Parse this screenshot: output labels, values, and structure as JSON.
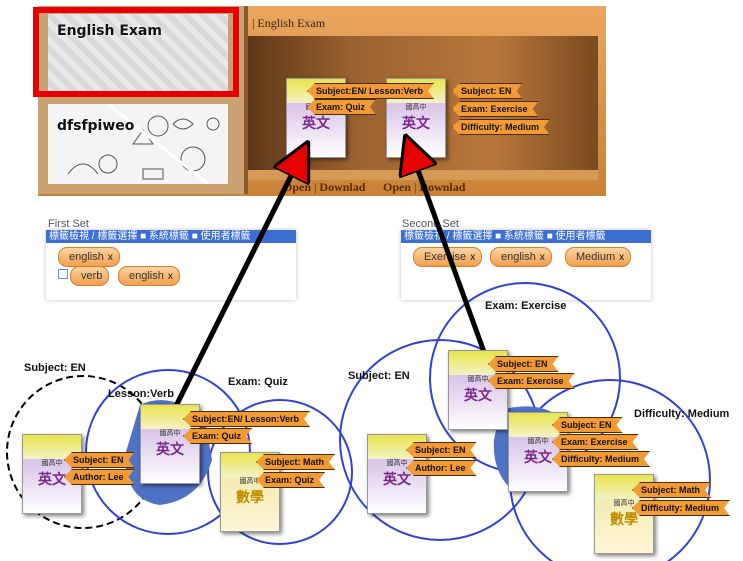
{
  "shelf": {
    "papers": [
      "English Exam",
      "dfsfpiweo"
    ],
    "title": "| English Exam",
    "links": [
      {
        "open": "Open",
        "sep": "|",
        "download": "Downlad"
      },
      {
        "open": "Open",
        "sep": "|",
        "download": "Downlad"
      }
    ],
    "book1_tags": [
      "Subject:EN/ Lesson:Verb",
      "Exam: Quiz"
    ],
    "book2_tags": [
      "Subject: EN",
      "Exam: Exercise",
      "Difficulty: Medium"
    ]
  },
  "first_set": {
    "title": "First Set",
    "bar": "標籤檢視 / 標籤選擇  ■ 系統標籤  ■ 使用者標籤",
    "chips": [
      "english",
      "verb",
      "english"
    ],
    "chip_x": "x"
  },
  "second_set": {
    "title": "Second Set",
    "bar": "標籤檢視 / 標籤選擇  ■ 系統標籤  ■ 使用者標籤",
    "chips": [
      "Exercise",
      "english",
      "Medium"
    ],
    "chip_x": "x"
  },
  "venn_left": {
    "labels": [
      "Subject: EN",
      "Lesson:Verb",
      "Exam: Quiz"
    ],
    "book_a_tags": [
      "Subject: EN",
      "Author: Lee"
    ],
    "book_b_tags": [
      "Subject:EN/ Lesson:Verb",
      "Exam: Quiz"
    ],
    "book_c_tags": [
      "Subject: Math",
      "Exam: Quiz"
    ]
  },
  "venn_right": {
    "labels": [
      "Subject: EN",
      "Exam: Exercise",
      "Difficulty: Medium"
    ],
    "book_a_tags": [
      "Subject: EN",
      "Exam: Exercise"
    ],
    "book_b_tags": [
      "Subject: EN",
      "Author: Lee"
    ],
    "book_c_tags": [
      "Subject: EN",
      "Exam: Exercise",
      "Difficulty: Medium"
    ],
    "book_d_tags": [
      "Subject: Math",
      "Difficulty: Medium"
    ]
  },
  "book_text": {
    "english": "英文",
    "math": "數學",
    "series": "國高中"
  },
  "colors": {
    "red_box": "#e60000",
    "tag_orange": "#f29a33",
    "circle_blue": "#3340d6",
    "highlight_blue": "#4f73c4",
    "bar_blue": "#3c6fd1"
  }
}
